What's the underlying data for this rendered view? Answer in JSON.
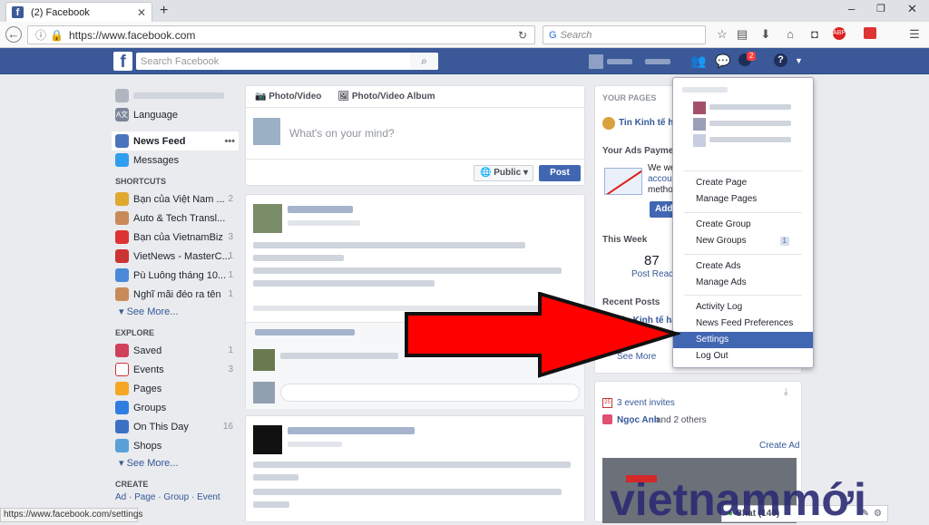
{
  "browser": {
    "tab_title": "(2) Facebook",
    "url": "https://www.facebook.com",
    "search_placeholder": "Search",
    "status_url": "https://www.facebook.com/settings"
  },
  "fb": {
    "search_placeholder": "Search Facebook",
    "notification_count": "2"
  },
  "left": {
    "language": "Language",
    "news_feed": "News Feed",
    "messages": "Messages",
    "shortcuts_title": "SHORTCUTS",
    "shortcuts": [
      {
        "label": "Bạn của Việt Nam ...",
        "count": "2"
      },
      {
        "label": "Auto & Tech Transl...",
        "count": ""
      },
      {
        "label": "Bạn của VietnamBiz",
        "count": "3"
      },
      {
        "label": "VietNews - MasterC...",
        "count": "1"
      },
      {
        "label": "Pù Luông tháng 10...",
        "count": "1"
      },
      {
        "label": "Nghĩ mãi đéo ra tên",
        "count": "1"
      }
    ],
    "see_more": "See More...",
    "explore_title": "EXPLORE",
    "explore": [
      {
        "label": "Saved",
        "count": "1"
      },
      {
        "label": "Events",
        "count": "3"
      },
      {
        "label": "Pages",
        "count": ""
      },
      {
        "label": "Groups",
        "count": ""
      },
      {
        "label": "On This Day",
        "count": "16"
      },
      {
        "label": "Shops",
        "count": ""
      }
    ],
    "create_title": "CREATE",
    "create_links": [
      "Ad",
      "Page",
      "Group",
      "Event"
    ]
  },
  "composer": {
    "photo_video": "Photo/Video",
    "photo_album": "Photo/Video Album",
    "placeholder": "What's on your mind?",
    "audience": "Public",
    "post": "Post"
  },
  "right": {
    "your_pages": "YOUR PAGES",
    "page_name": "Tin Kinh tế hàng",
    "ads_payment": "Your Ads Payment",
    "ads_text1": "We we",
    "ads_text2": "accou",
    "ads_text3": "metho",
    "add_button": "Add",
    "this_week": "This Week",
    "post_reach_value": "87",
    "post_reach": "Post Reach",
    "recent_posts": "Recent Posts",
    "recent_post_name": "Tin Kinh tế hàng",
    "see_more": "See More",
    "event_invites": "3 event invites",
    "invite_name": "Ngọc Anh",
    "invite_rest": "and 2 others",
    "create_ad": "Create Ad",
    "chat": "Chat (140)"
  },
  "dropdown": {
    "create_page": "Create Page",
    "manage_pages": "Manage Pages",
    "create_group": "Create Group",
    "new_groups": "New Groups",
    "new_groups_badge": "1",
    "create_ads": "Create Ads",
    "manage_ads": "Manage Ads",
    "activity_log": "Activity Log",
    "news_feed_prefs": "News Feed Preferences",
    "settings": "Settings",
    "log_out": "Log Out"
  },
  "watermark": "vietnammới",
  "colors": {
    "fb_blue": "#3b5998",
    "link": "#365899",
    "arrow": "#ff0000",
    "highlight": "#4267b2"
  }
}
